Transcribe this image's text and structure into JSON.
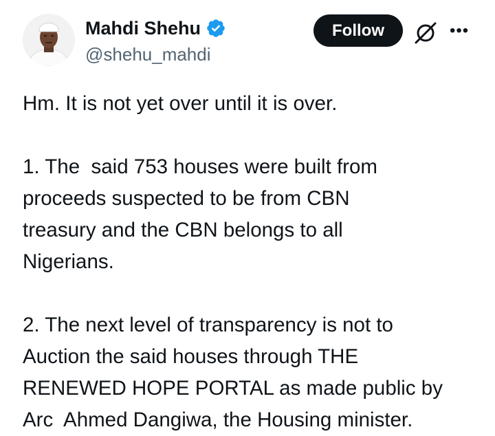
{
  "author": {
    "display_name": "Mahdi Shehu",
    "handle": "@shehu_mahdi",
    "verified": true,
    "verified_color": "#1d9bf0",
    "avatar_icon": "profile-photo"
  },
  "actions": {
    "follow_label": "Follow",
    "grok_icon": "grok-icon",
    "more_icon": "more-icon",
    "more_glyph": "•••"
  },
  "tweet": {
    "paragraphs": [
      "Hm. It is not yet over until it is over.",
      "1. The  said 753 houses were built from\nproceeds suspected to be from CBN\ntreasury and the CBN belongs to all\nNigerians.",
      "2. The next level of transparency is not to\nAuction the said houses through THE\nRENEWED HOPE PORTAL as made public by\nArc  Ahmed Dangiwa, the Housing minister."
    ]
  }
}
